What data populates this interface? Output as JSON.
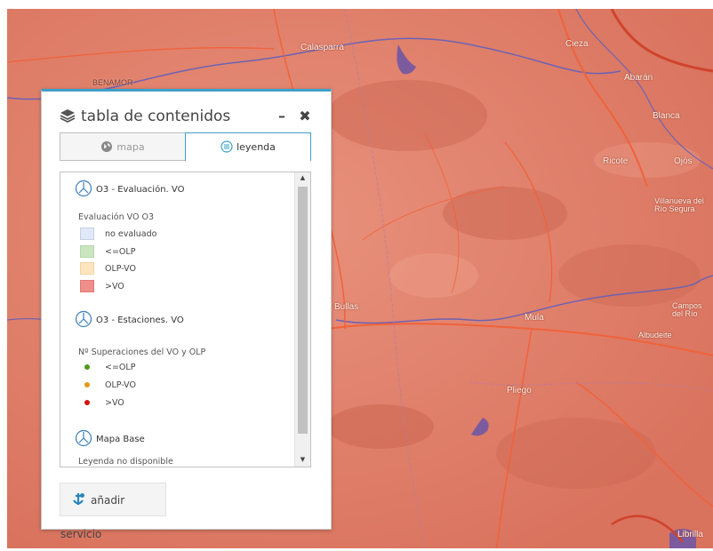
{
  "map": {
    "places": [
      {
        "id": "calasparra",
        "name": "Calasparra"
      },
      {
        "id": "cieza",
        "name": "Cieza"
      },
      {
        "id": "abaran",
        "name": "Abarán"
      },
      {
        "id": "blanca",
        "name": "Blanca"
      },
      {
        "id": "ricote",
        "name": "Ricote"
      },
      {
        "id": "ojos",
        "name": "Ojós"
      },
      {
        "id": "villanueva",
        "name": "Villanueva del Río Segura"
      },
      {
        "id": "benamor",
        "name": "BENAMOR"
      },
      {
        "id": "bullas",
        "name": "Bullas"
      },
      {
        "id": "mula",
        "name": "Mula"
      },
      {
        "id": "campos",
        "name": "Campos del Río"
      },
      {
        "id": "albudeite",
        "name": "Albudeite"
      },
      {
        "id": "pliego",
        "name": "Pliego"
      },
      {
        "id": "librilla",
        "name": "Librilla"
      }
    ]
  },
  "panel": {
    "title": "tabla de contenidos",
    "minimize": "–",
    "close": "✖",
    "tabs": {
      "mapa": "mapa",
      "leyenda": "leyenda"
    },
    "layers": [
      {
        "title": "O3 - Evaluación. VO",
        "subtitle": "Evaluación VO O3",
        "items": [
          {
            "label": "no evaluado",
            "color": "#e1e8f8",
            "border": "#c5cfe4"
          },
          {
            "label": "<=OLP",
            "color": "#c9e6c1",
            "border": "#b5d8ac"
          },
          {
            "label": "OLP-VO",
            "color": "#fde5be",
            "border": "#f2d4a4"
          },
          {
            "label": ">VO",
            "color": "#ee8f8a",
            "border": "#e27b76"
          }
        ]
      },
      {
        "title": "O3 - Estaciones. VO",
        "subtitle": "Nº Superaciones del VO y OLP",
        "items": [
          {
            "label": "<=OLP",
            "color": "#4f9a1e"
          },
          {
            "label": "OLP-VO",
            "color": "#e59a19"
          },
          {
            "label": ">VO",
            "color": "#d21313"
          }
        ]
      },
      {
        "title": "Mapa Base",
        "subtitle": "Leyenda no disponible",
        "items": []
      }
    ],
    "add_service": "añadir servicio"
  }
}
